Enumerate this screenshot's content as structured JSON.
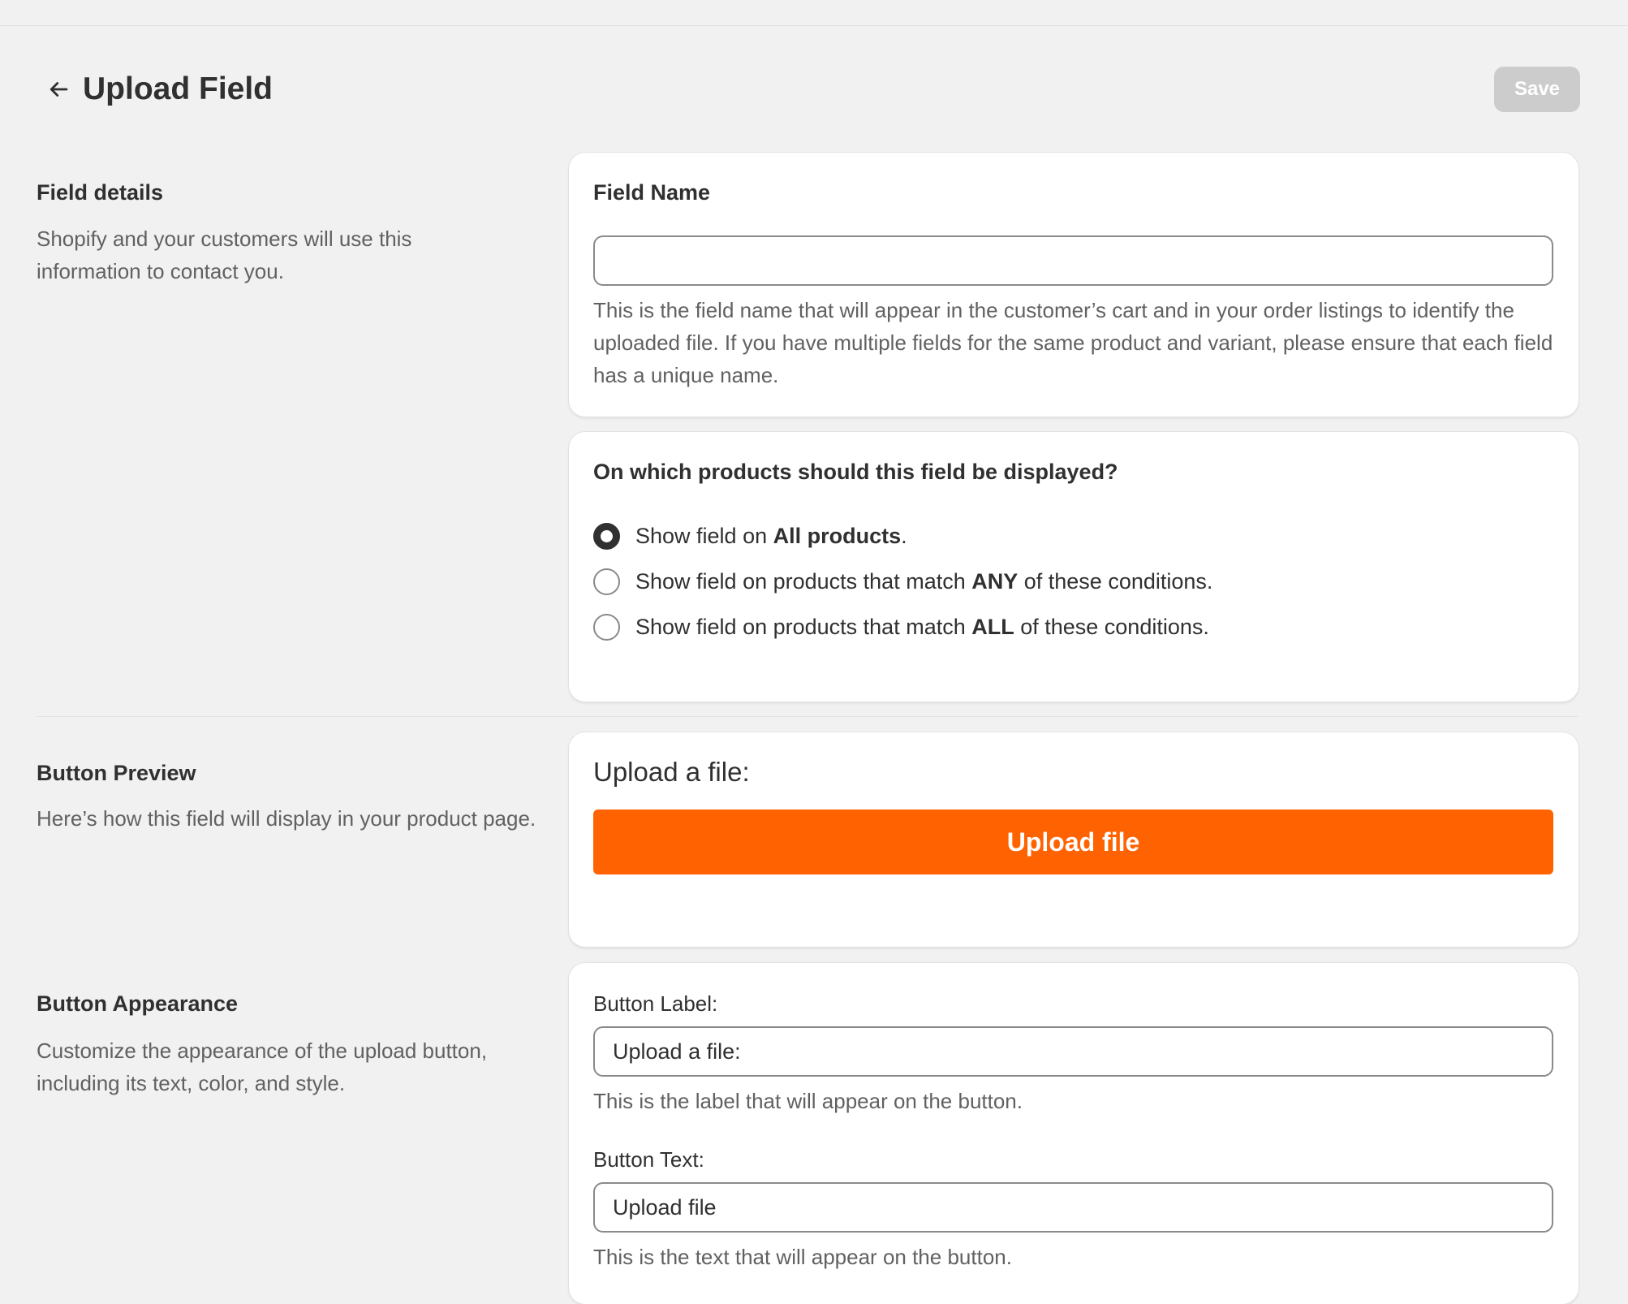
{
  "header": {
    "title": "Upload Field",
    "save_label": "Save"
  },
  "field_details": {
    "title": "Field details",
    "description": "Shopify and your customers will use this information to contact you.",
    "field_name_label": "Field Name",
    "field_name_value": "",
    "field_name_help": "This is the field name that will appear in the customer’s cart and in your order listings to identify the uploaded file. If you have multiple fields for the same product and variant, please ensure that each field has a unique name."
  },
  "display": {
    "question": "On which products should this field be displayed?",
    "options": [
      {
        "prefix": "Show field on ",
        "bold": "All products",
        "suffix": ".",
        "checked": true
      },
      {
        "prefix": "Show field on products that match ",
        "bold": "ANY",
        "suffix": " of these conditions.",
        "checked": false
      },
      {
        "prefix": "Show field on products that match ",
        "bold": "ALL",
        "suffix": " of these conditions.",
        "checked": false
      }
    ]
  },
  "preview": {
    "title": "Button Preview",
    "description": "Here’s how this field will display in your product page.",
    "label": "Upload a file:",
    "button_text": "Upload file",
    "button_color": "#ff6200"
  },
  "appearance": {
    "title": "Button Appearance",
    "description": "Customize the appearance of the upload button, including its text, color, and style.",
    "label_field_label": "Button Label:",
    "label_field_value": "Upload a file:",
    "label_field_help": "This is the label that will appear on the button.",
    "text_field_label": "Button Text:",
    "text_field_value": "Upload file",
    "text_field_help": "This is the text that will appear on the button."
  },
  "icons": {
    "back": "arrow-left-icon"
  }
}
